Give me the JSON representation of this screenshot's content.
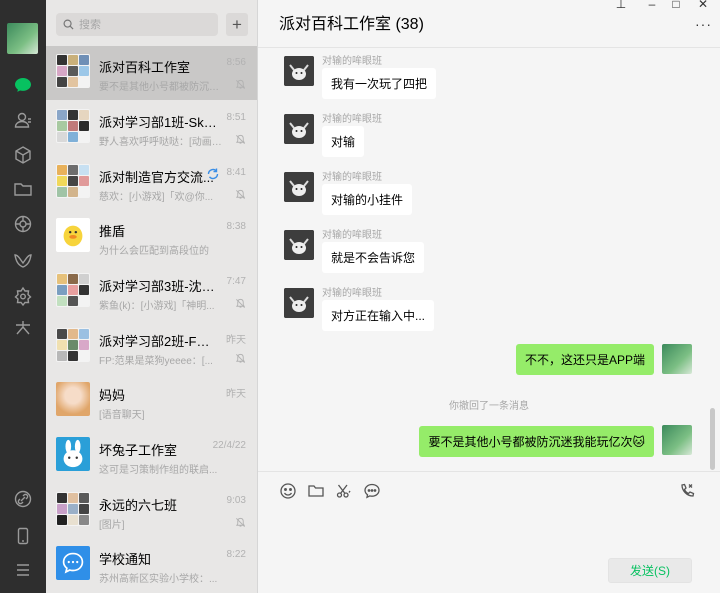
{
  "search": {
    "placeholder": "搜索"
  },
  "add_label": "+",
  "chats": [
    {
      "name": "派对百科工作室",
      "time": "8:56",
      "preview": "要不是其他小号都被防沉迷我能玩亿次",
      "muted": true,
      "active": true
    },
    {
      "name": "派对学习部1班-Sky...",
      "time": "8:51",
      "preview": "野人喜欢呼呼哒哒：[动画表情]",
      "muted": true
    },
    {
      "name": "派对制造官方交流...",
      "time": "8:41",
      "preview": "慈欢：[小游戏]「欢@你...",
      "muted": true
    },
    {
      "name": "推盾",
      "time": "8:38",
      "preview": "为什么会匹配到高段位的",
      "muted": false
    },
    {
      "name": "派对学习部3班-沈阳...",
      "time": "7:47",
      "preview": "紫鱼(k)：[小游戏]「神明...",
      "muted": true
    },
    {
      "name": "派对学习部2班-FP收...",
      "time": "昨天",
      "preview": "FP:范果是菜狗yeeee：[...",
      "muted": true
    },
    {
      "name": "妈妈",
      "time": "昨天",
      "preview": "[语音聊天]",
      "muted": false
    },
    {
      "name": "坏兔子工作室",
      "time": "22/4/22",
      "preview": "这可是习策制作组的联启...",
      "muted": false
    },
    {
      "name": "永远的六七班",
      "time": "9:03",
      "preview": "[图片]",
      "muted": true
    },
    {
      "name": "学校通知",
      "time": "8:22",
      "preview": "苏州高新区实验小学校：...",
      "muted": false
    }
  ],
  "chat": {
    "title": "派对百科工作室 (38)",
    "more_label": "···",
    "messages": [
      {
        "sender": "对输的哞眼班",
        "text": "我有一次玩了四把"
      },
      {
        "sender": "对输的哞眼班",
        "text": "对输"
      },
      {
        "sender": "对输的哞眼班",
        "text": "对输的小挂件"
      },
      {
        "sender": "对输的哞眼班",
        "text": "就是不会告诉您"
      },
      {
        "sender": "对输的哞眼班",
        "text": "对方正在输入中..."
      }
    ],
    "outgoing": [
      {
        "text": "不不，这还只是APP端"
      },
      {
        "text": "要不是其他小号都被防沉迷我能玩亿次🐱"
      }
    ],
    "system_notice": "你撤回了一条消息",
    "send_label": "发送(S)"
  },
  "window_controls": {
    "pin": "⊥",
    "minimize": "–",
    "maximize": "□",
    "close": "✕"
  },
  "colors": {
    "rail": "#2e2e2e",
    "list_bg": "#e8e7e6",
    "active_item": "#c9c8c7",
    "chat_bg": "#f5f5f5",
    "outgoing_bubble": "#95ec69",
    "accent": "#07c160"
  }
}
